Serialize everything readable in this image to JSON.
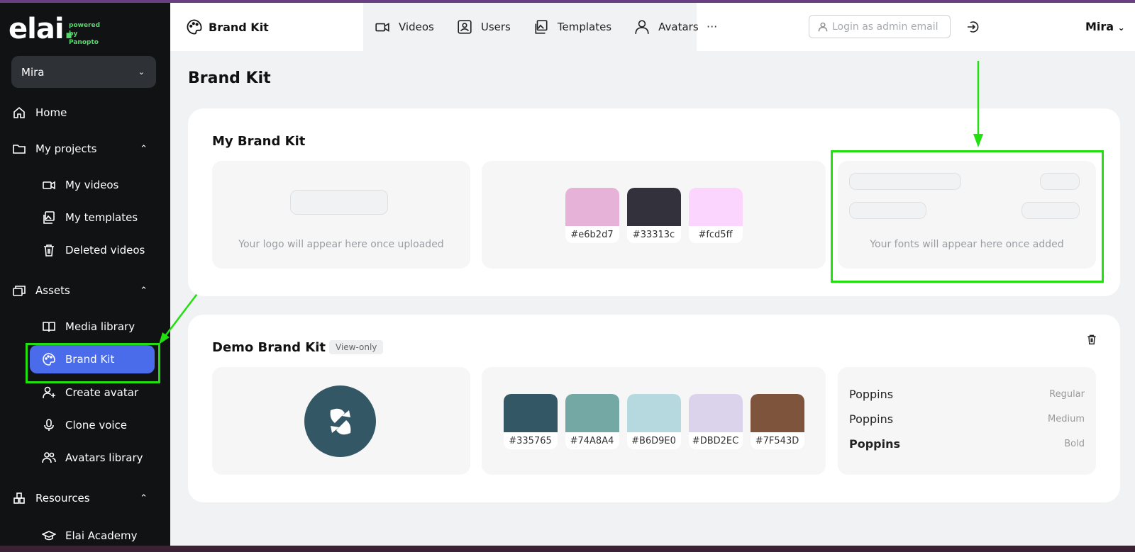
{
  "sidebar": {
    "logo_text": "elai",
    "logo_sub": "powered by Panopto",
    "workspace": "Mira",
    "items": [
      {
        "label": "Home"
      },
      {
        "label": "My projects"
      },
      {
        "label": "My videos"
      },
      {
        "label": "My templates"
      },
      {
        "label": "Deleted videos"
      },
      {
        "label": "Assets"
      },
      {
        "label": "Media library"
      },
      {
        "label": "Brand Kit"
      },
      {
        "label": "Create avatar"
      },
      {
        "label": "Clone voice"
      },
      {
        "label": "Avatars library"
      },
      {
        "label": "Resources"
      },
      {
        "label": "Elai Academy"
      }
    ]
  },
  "topbar": {
    "title": "Brand Kit",
    "tabs": [
      {
        "label": "Videos"
      },
      {
        "label": "Users"
      },
      {
        "label": "Templates"
      },
      {
        "label": "Avatars"
      }
    ],
    "more": "···",
    "search_placeholder": "Login as admin email",
    "user": "Mira"
  },
  "page_title": "Brand Kit",
  "my_kit": {
    "title": "My Brand Kit",
    "logo_placeholder": "Your logo will appear here once uploaded",
    "colors": [
      {
        "hex": "#e6b2d7",
        "label": "#e6b2d7"
      },
      {
        "hex": "#33313c",
        "label": "#33313c"
      },
      {
        "hex": "#fcd5ff",
        "label": "#fcd5ff"
      }
    ],
    "fonts_placeholder": "Your fonts will appear here once added"
  },
  "demo_kit": {
    "title": "Demo Brand Kit",
    "badge": "View-only",
    "colors": [
      {
        "hex": "#335765",
        "label": "#335765"
      },
      {
        "hex": "#74A8A4",
        "label": "#74A8A4"
      },
      {
        "hex": "#B6D9E0",
        "label": "#B6D9E0"
      },
      {
        "hex": "#DBD2EC",
        "label": "#DBD2EC"
      },
      {
        "hex": "#7F543D",
        "label": "#7F543D"
      }
    ],
    "fonts": [
      {
        "name": "Poppins",
        "weight": "Regular"
      },
      {
        "name": "Poppins",
        "weight": "Medium"
      },
      {
        "name": "Poppins",
        "weight": "Bold"
      }
    ]
  },
  "colors": {
    "accent": "#4a6bea",
    "highlight": "#22e010",
    "sidebar_bg": "#111213"
  }
}
